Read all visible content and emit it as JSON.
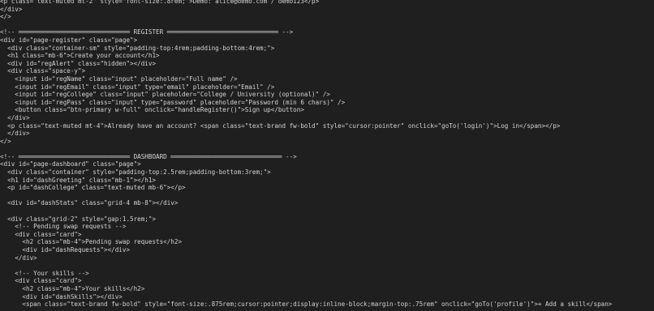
{
  "code_lines": [
    "<p class=\"text-muted mt-2\" style=\"font-size:.8rem;\">Demo: alice@demo.com / demo123</p>",
    "</div>",
    "</>",
    "",
    "<!-- ══════════════════════════════ REGISTER ══════════════════════════════ -->",
    "<div id=\"page-register\" class=\"page\">",
    "  <div class=\"container-sm\" style=\"padding-top:4rem;padding-bottom:4rem;\">",
    "  <h1 class=\"mb-6\">Create your account</h1>",
    "  <div id=\"regAlert\" class=\"hidden\"></div>",
    "  <div class=\"space-y\">",
    "    <input id=\"regName\" class=\"input\" placeholder=\"Full name\" />",
    "    <input id=\"regEmail\" class=\"input\" type=\"email\" placeholder=\"Email\" />",
    "    <input id=\"regCollege\" class=\"input\" placeholder=\"College / University (optional)\" />",
    "    <input id=\"regPass\" class=\"input\" type=\"password\" placeholder=\"Password (min 6 chars)\" />",
    "    <button class=\"btn-primary w-full\" onclick=\"handleRegister()\">Sign up</button>",
    "  </div>",
    "  <p class=\"text-muted mt-4\">Already have an account? <span class=\"text-brand fw-bold\" style=\"cursor:pointer\" onclick=\"goTo('login')\">Log in</span></p>",
    "  </div>",
    "</>",
    "",
    "<!-- ══════════════════════════════ DASHBOARD ══════════════════════════════ -->",
    "<div id=\"page-dashboard\" class=\"page\">",
    "  <div class=\"container\" style=\"padding-top:2.5rem;padding-bottom:3rem;\">",
    "  <h1 id=\"dashGreeting\" class=\"mb-1\"></h1>",
    "  <p id=\"dashCollege\" class=\"text-muted mb-6\"></p>",
    "",
    "  <div id=\"dashStats\" class=\"grid-4 mb-8\"></div>",
    "",
    "  <div class=\"grid-2\" style=\"gap:1.5rem;\">",
    "    <!-- Pending swap requests -->",
    "    <div class=\"card\">",
    "      <h2 class=\"mb-4\">Pending swap requests</h2>",
    "      <div id=\"dashRequests\"></div>",
    "    </div>",
    "",
    "    <!-- Your skills -->",
    "    <div class=\"card\">",
    "      <h2 class=\"mb-4\">Your skills</h2>",
    "      <div id=\"dashSkills\"></div>",
    "      <span class=\"text-brand fw-bold\" style=\"font-size:.875rem;cursor:pointer;display:inline-block;margin-top:.75rem\" onclick=\"goTo('profile')\">+ Add a skill</span>"
  ],
  "colors": {
    "background": "#1f1f1f",
    "text": "#d4d4d4"
  }
}
